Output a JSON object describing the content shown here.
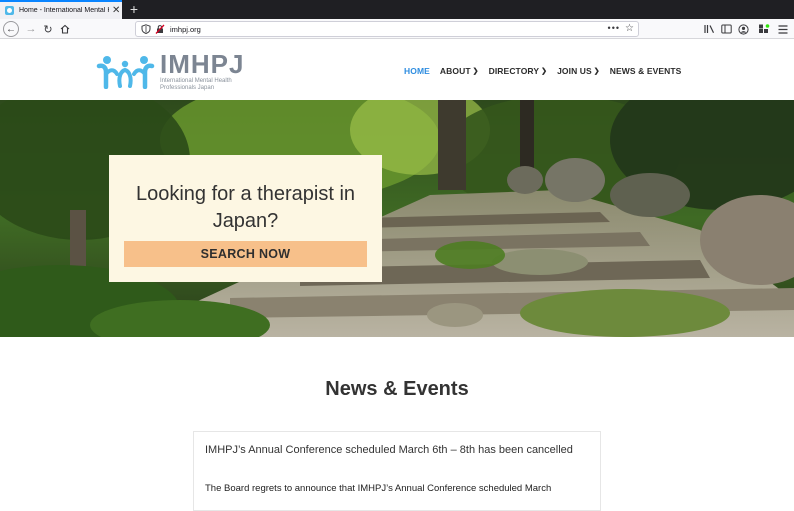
{
  "browser": {
    "tab_title": "Home - International Mental He",
    "tab_close": "✕",
    "new_tab": "+",
    "url": "imhpj.org",
    "url_more": "•••",
    "icons": [
      "back-icon",
      "forward-icon",
      "reload-icon",
      "home-icon",
      "shield-icon",
      "insecure-lock-icon",
      "bookmark-star-icon",
      "library-icon",
      "sidebar-icon",
      "account-icon",
      "extensions-icon",
      "menu-icon"
    ]
  },
  "site": {
    "logo_name": "IMHPJ",
    "logo_subtitle": "International Mental Health Professionals Japan",
    "logo_color": "#4fb8e9",
    "nav": [
      {
        "label": "HOME",
        "active": true
      },
      {
        "label": "ABOUT",
        "dropdown": true
      },
      {
        "label": "DIRECTORY",
        "dropdown": true
      },
      {
        "label": "JOIN US",
        "dropdown": true
      },
      {
        "label": "NEWS & EVENTS"
      }
    ],
    "accent_color": "#2e8de0"
  },
  "hero": {
    "title": "Looking for a therapist in Japan?",
    "button_label": "SEARCH NOW",
    "button_color": "#f7c08a",
    "card_color": "#fdf7e3"
  },
  "news": {
    "heading": "News & Events",
    "items": [
      {
        "title": "IMHPJ’s Annual Conference scheduled March 6th – 8th has been cancelled",
        "body": "The Board regrets to announce that IMHPJ’s Annual Conference scheduled March"
      }
    ]
  }
}
